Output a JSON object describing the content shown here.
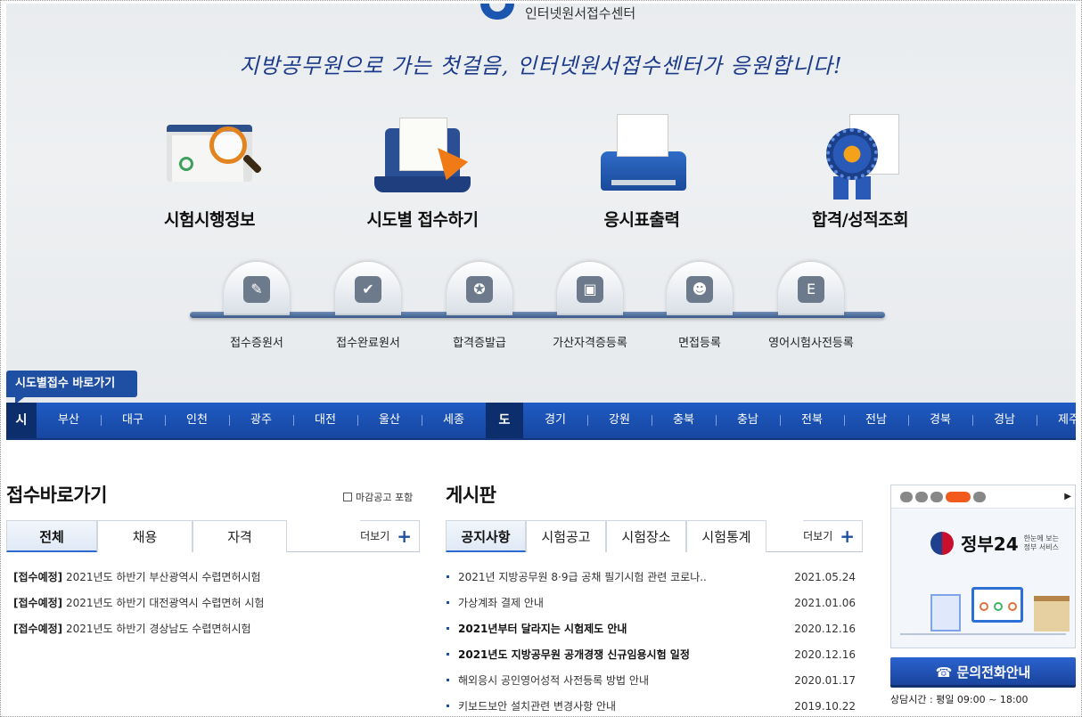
{
  "header": {
    "logo_text": "인터넷원서접수센터",
    "slogan": "지방공무원으로 가는 첫걸음, 인터넷원서접수센터가 응원합니다!"
  },
  "main_menu": [
    {
      "label": "시험시행정보",
      "icon": "folder-search-icon"
    },
    {
      "label": "시도별 접수하기",
      "icon": "laptop-apply-icon"
    },
    {
      "label": "응시표출력",
      "icon": "printer-icon"
    },
    {
      "label": "합격/성적조회",
      "icon": "medal-icon"
    }
  ],
  "sub_menu": [
    {
      "label": "접수증원서",
      "icon": "pencil-icon",
      "glyph": "✎"
    },
    {
      "label": "접수완료원서",
      "icon": "check-doc-icon",
      "glyph": "✔"
    },
    {
      "label": "합격증발급",
      "icon": "ribbon-icon",
      "glyph": "✪"
    },
    {
      "label": "가산자격증등록",
      "icon": "id-card-icon",
      "glyph": "▣"
    },
    {
      "label": "면접등록",
      "icon": "interview-icon",
      "glyph": "☻"
    },
    {
      "label": "영어시험사전등록",
      "icon": "eng-doc-icon",
      "glyph": "E"
    }
  ],
  "region": {
    "tag": "시도별접수 바로가기",
    "si_label": "시",
    "si": [
      "부산",
      "대구",
      "인천",
      "광주",
      "대전",
      "울산",
      "세종"
    ],
    "do_label": "도",
    "do": [
      "경기",
      "강원",
      "충북",
      "충남",
      "전북",
      "전남",
      "경북",
      "경남",
      "제주"
    ]
  },
  "apply": {
    "title": "접수바로가기",
    "checkbox_label": "마감공고 포함",
    "tabs": [
      "전체",
      "채용",
      "자격"
    ],
    "more": "더보기",
    "items": [
      {
        "tag": "[접수예정]",
        "text": "2021년도 하반기 부산광역시 수렵면허시험"
      },
      {
        "tag": "[접수예정]",
        "text": "2021년도 하반기 대전광역시 수렵면허 시험"
      },
      {
        "tag": "[접수예정]",
        "text": "2021년도 하반기 경상남도 수렵면허시험"
      }
    ]
  },
  "board": {
    "title": "게시판",
    "tabs": [
      "공지사항",
      "시험공고",
      "시험장소",
      "시험통계"
    ],
    "more": "더보기",
    "items": [
      {
        "text": "2021년 지방공무원 8·9급 공채 필기시험 관련 코로나..",
        "date": "2021.05.24",
        "bold": false
      },
      {
        "text": "가상계좌 결제 안내",
        "date": "2021.01.06",
        "bold": false
      },
      {
        "text": "2021년부터 달라지는 시험제도 안내",
        "date": "2020.12.16",
        "bold": true
      },
      {
        "text": "2021년도 지방공무원 공개경쟁 신규임용시험 일정",
        "date": "2020.12.16",
        "bold": true
      },
      {
        "text": "해외응시 공인영어성적 사전등록 방법 안내",
        "date": "2020.01.17",
        "bold": false
      },
      {
        "text": "키보드보안 설치관련 변경사항 안내",
        "date": "2019.10.22",
        "bold": false
      }
    ]
  },
  "banner": {
    "title": "정부24",
    "subtitle": "한눈에 보는 정부 서비스",
    "next": "▶"
  },
  "call": {
    "label": "☎ 문의전화안내",
    "hours": "상담시간 : 평일 09:00 ~ 18:00"
  },
  "colors": {
    "primary": "#1f4fa3",
    "accent": "#f07b16",
    "region_bar": "#1f5bc4"
  }
}
